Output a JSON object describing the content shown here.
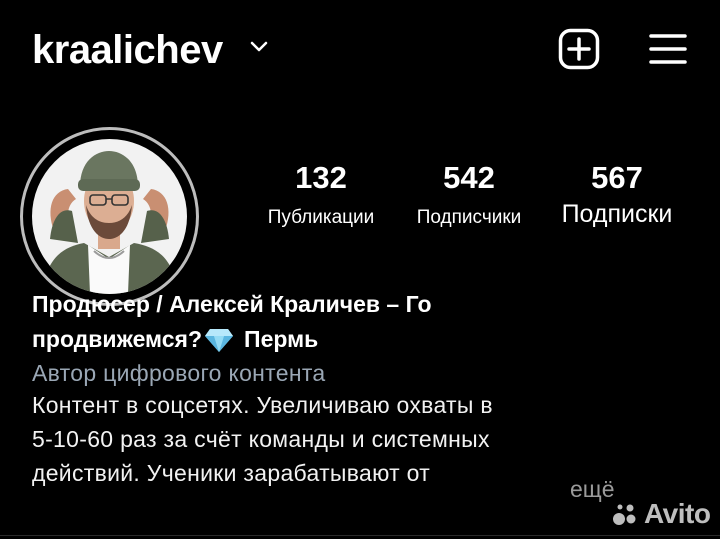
{
  "header": {
    "username": "kraalichev",
    "new_post_icon": "plus-square-icon",
    "menu_icon": "hamburger-menu-icon"
  },
  "stats": {
    "posts": {
      "count": "132",
      "label": "Публикации"
    },
    "followers": {
      "count": "542",
      "label": "Подписчики"
    },
    "following": {
      "count": "567",
      "label": "Подписки"
    }
  },
  "bio": {
    "name_line1": "Продюсер / Алексей Краличев – Го",
    "name_line2_before": "продвижемся?",
    "name_line2_after": "Пермь",
    "category": "Автор цифрового контента",
    "text_line1": "Контент в соцсетях. Увеличиваю охваты в",
    "text_line2": "5-10-60 раз за счёт команды и системных",
    "text_line3": "действий. Ученики зарабатывают от",
    "more": "ещё"
  },
  "watermark": {
    "text": "Avito"
  },
  "colors": {
    "background": "#000000",
    "text": "#ffffff",
    "category": "#9aa7b5",
    "muted": "#9a9a9a"
  }
}
